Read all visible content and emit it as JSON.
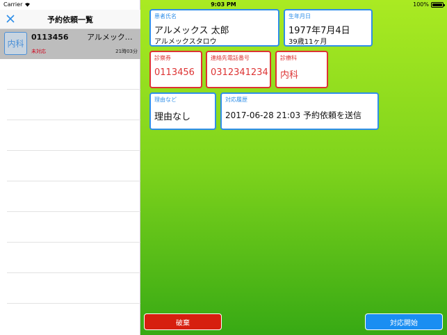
{
  "status_bar": {
    "carrier": "Carrier",
    "time": "9:03 PM",
    "battery": "100%"
  },
  "sidebar": {
    "title": "予約依頼一覧",
    "items": [
      {
        "dept_icon": "内科",
        "id": "0113456",
        "name": "アルメックス太郎",
        "status": "未対応",
        "elapsed": "21時03分"
      }
    ]
  },
  "detail": {
    "patient_name": {
      "label": "患者氏名",
      "value": "アルメックス 太郎",
      "kana": "アルメックスタロウ"
    },
    "birthdate": {
      "label": "生年月日",
      "value": "1977年7月4日",
      "age": "39歳11ヶ月"
    },
    "exam_ticket": {
      "label": "診察券",
      "value": "0113456"
    },
    "phone": {
      "label": "連絡先電話番号",
      "value": "0312341234"
    },
    "department": {
      "label": "診療科",
      "value": "内科"
    },
    "reason": {
      "label": "理由など",
      "value": "理由なし"
    },
    "history": {
      "label": "対応履歴",
      "value": "2017-06-28 21:03 予約依頼を送信"
    }
  },
  "actions": {
    "discard_label": "破棄",
    "start_label": "対応開始"
  },
  "colors": {
    "accent_blue": "#2e8ee8",
    "alert_red": "#d33333",
    "discard_button": "#d61f0f",
    "start_button": "#1a8ef2"
  }
}
